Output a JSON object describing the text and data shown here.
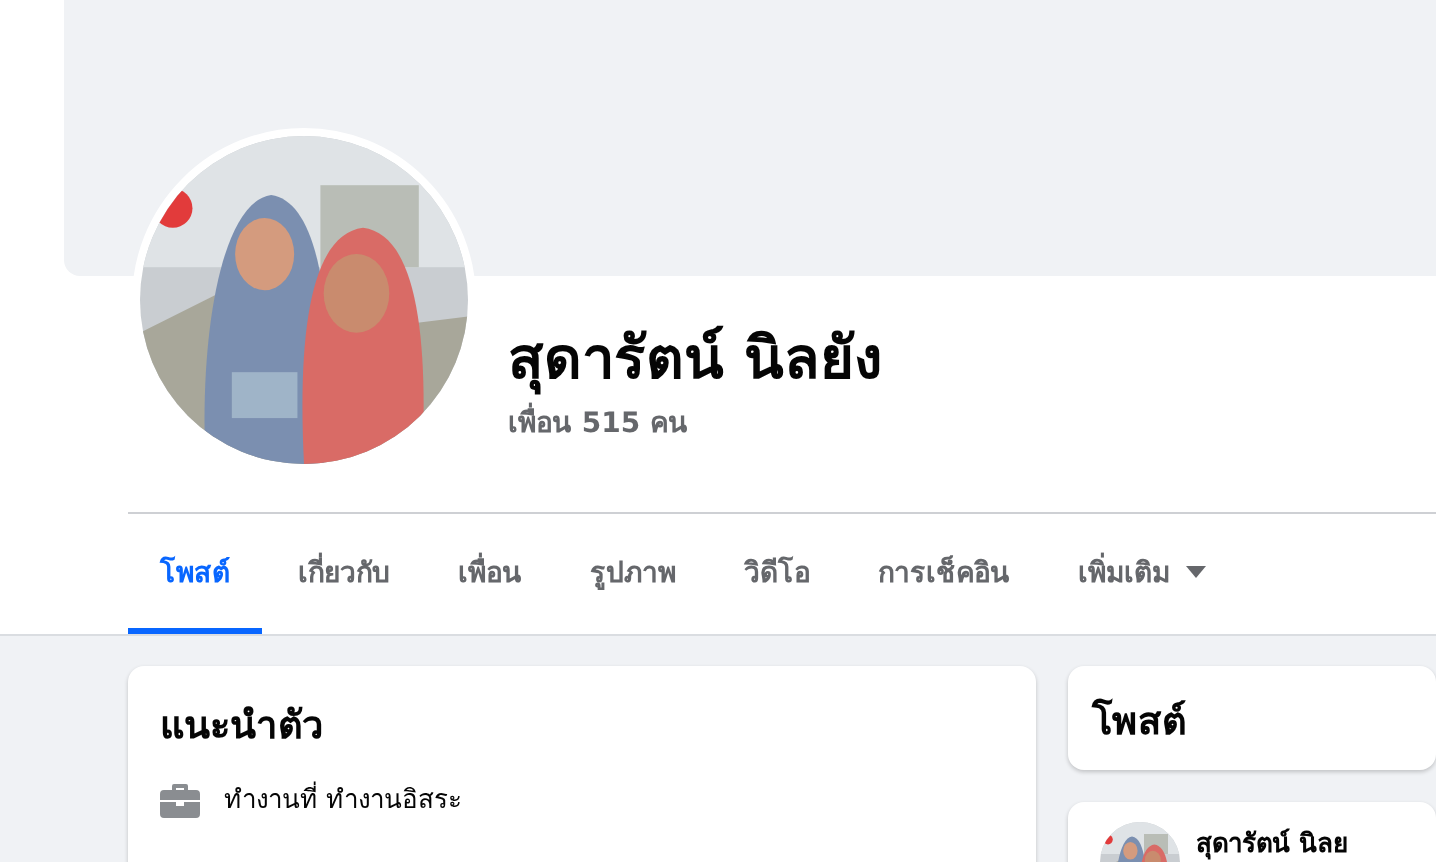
{
  "profile": {
    "name": "สุดารัตน์ นิลยัง",
    "friends": "เพื่อน 515 คน"
  },
  "tabs": [
    {
      "label": "โพสต์",
      "selected": true,
      "kind": "link"
    },
    {
      "label": "เกี่ยวกับ",
      "selected": false,
      "kind": "link"
    },
    {
      "label": "เพื่อน",
      "selected": false,
      "kind": "link"
    },
    {
      "label": "รูปภาพ",
      "selected": false,
      "kind": "link"
    },
    {
      "label": "วิดีโอ",
      "selected": false,
      "kind": "link"
    },
    {
      "label": "การเช็คอิน",
      "selected": false,
      "kind": "link"
    },
    {
      "label": "เพิ่มเติม",
      "selected": false,
      "kind": "menu"
    }
  ],
  "intro": {
    "title": "แนะนำตัว",
    "items": [
      {
        "kind": "work",
        "text": "ทำงานที่ ทำงานอิสระ"
      }
    ]
  },
  "posts": {
    "title": "โพสต์"
  },
  "post_preview": {
    "author": "สุดารัตน์ นิลย"
  }
}
